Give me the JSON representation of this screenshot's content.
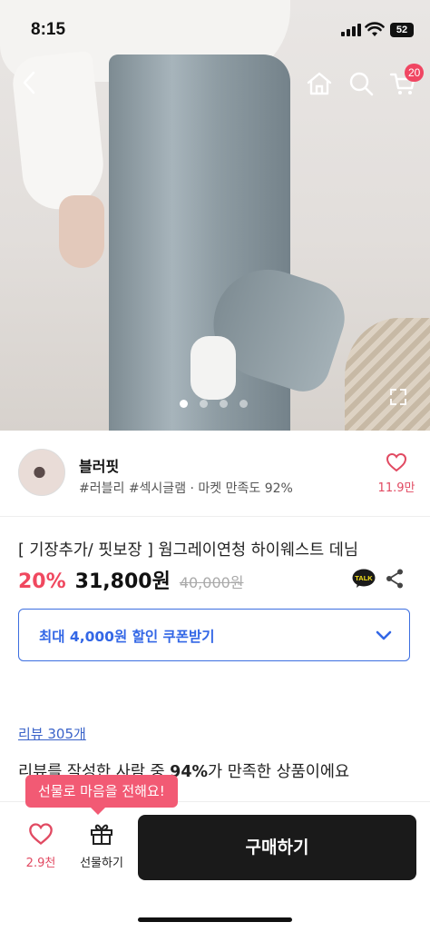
{
  "status_bar": {
    "time": "8:15",
    "battery": "52"
  },
  "header": {
    "cart_badge": "20"
  },
  "gallery": {
    "dot_count": 4,
    "active_index": 0
  },
  "store": {
    "name": "블러핏",
    "tags": "#러블리 #섹시글램 · 마켓 만족도 92%",
    "like_count": "11.9만"
  },
  "product": {
    "title": "[ 기장추가/ 핏보장 ] 웜그레이연청 하이웨스트 데님",
    "discount": "20%",
    "price": "31,800원",
    "original_price": "40,000원",
    "talk_label": "TALK"
  },
  "coupon": {
    "label": "최대 4,000원 할인 쿠폰받기"
  },
  "review": {
    "link": "리뷰 305개",
    "summary_prefix": "리뷰를 작성한 사람 중 ",
    "summary_percent": "94%",
    "summary_suffix": "가 만족한 상품이에요"
  },
  "bottom_bar": {
    "tooltip": "선물로 마음을 전해요!",
    "wish_count": "2.9천",
    "gift_label": "선물하기",
    "buy_label": "구매하기"
  },
  "colors": {
    "accent_pink": "#f0485f",
    "coupon_blue": "#3367e6",
    "buy_button": "#1a1a1a"
  }
}
